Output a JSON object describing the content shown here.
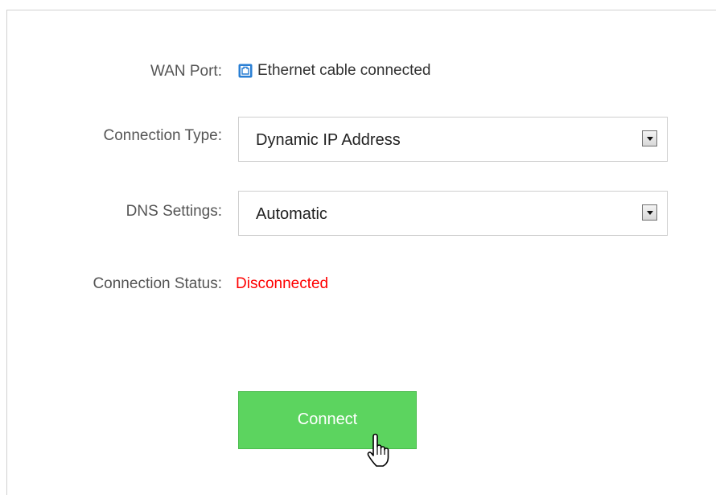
{
  "wan": {
    "label": "WAN Port:",
    "icon": "ethernet-port-icon",
    "status": "Ethernet cable connected",
    "icon_color": "#2a7fd4"
  },
  "connection_type": {
    "label": "Connection Type:",
    "selected": "Dynamic IP Address"
  },
  "dns": {
    "label": "DNS Settings:",
    "selected": "Automatic"
  },
  "status": {
    "label": "Connection Status:",
    "value": "Disconnected",
    "color": "#ff0000"
  },
  "actions": {
    "connect_label": "Connect",
    "button_color": "#5cd45f"
  },
  "cursor": {
    "icon": "hand-pointer-icon"
  }
}
